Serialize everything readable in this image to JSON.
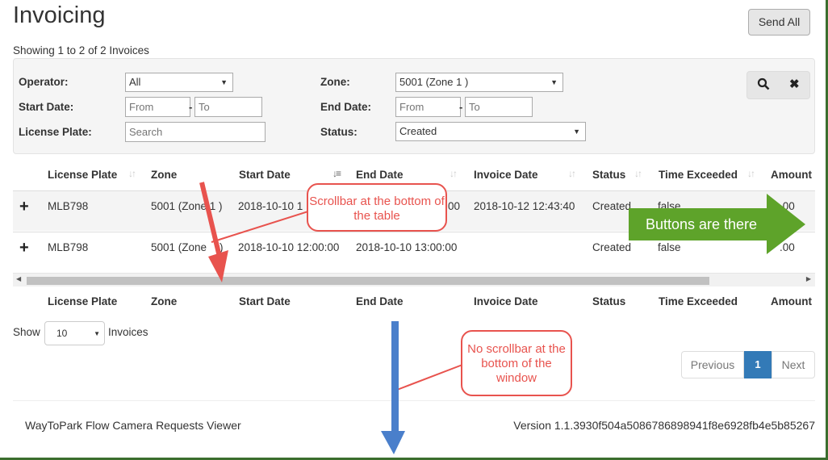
{
  "page": {
    "title": "Invoicing",
    "send_all": "Send All",
    "showing": "Showing 1 to 2 of 2 Invoices"
  },
  "filters": {
    "operator_label": "Operator:",
    "operator_value": "All",
    "start_date_label": "Start Date:",
    "start_from_placeholder": "From",
    "start_to_placeholder": "To",
    "license_plate_label": "License Plate:",
    "license_plate_placeholder": "Search",
    "zone_label": "Zone:",
    "zone_value": "5001 (Zone 1 )",
    "end_date_label": "End Date:",
    "end_from_placeholder": "From",
    "end_to_placeholder": "To",
    "status_label": "Status:",
    "status_value": "Created",
    "dash": "-",
    "search_icon": "search-icon",
    "clear_icon": "close-icon"
  },
  "table": {
    "columns": [
      "License Plate",
      "Zone",
      "Start Date",
      "End Date",
      "Invoice Date",
      "Status",
      "Time Exceeded",
      "Amount"
    ],
    "rows": [
      {
        "expand": "+",
        "license_plate": "MLB798",
        "zone": "5001 (Zone 1 )",
        "start_date": "2018-10-10 1",
        "end_date": "00",
        "invoice_date": "2018-10-12 12:43:40",
        "status": "Created",
        "time_exceeded": "false",
        "amount": ".00"
      },
      {
        "expand": "+",
        "license_plate": "MLB798",
        "zone": "5001 (Zone",
        "zone_tail": ")",
        "start_date": "2018-10-10 12:00:00",
        "end_date": "2018-10-10 13:00:00",
        "invoice_date": "",
        "status": "Created",
        "time_exceeded": "false",
        "amount": ".00"
      }
    ]
  },
  "length": {
    "show": "Show",
    "value": "10",
    "suffix": "Invoices"
  },
  "pagination": {
    "previous": "Previous",
    "current": "1",
    "next": "Next"
  },
  "footer": {
    "app_name": "WayToPark Flow Camera Requests Viewer",
    "version": "Version 1.1.3930f504a5086786898941f8e6928fb4e5b85267"
  },
  "annotations": {
    "scrollbar_note": "Scrollbar at the bottom of the table",
    "window_note": "No scrollbar at the bottom of the window",
    "buttons_note": "Buttons are there"
  },
  "colors": {
    "callout": "#e8534e",
    "green_arrow": "#5ea32a",
    "blue_arrow": "#4a7fcb",
    "primary": "#337ab7"
  }
}
